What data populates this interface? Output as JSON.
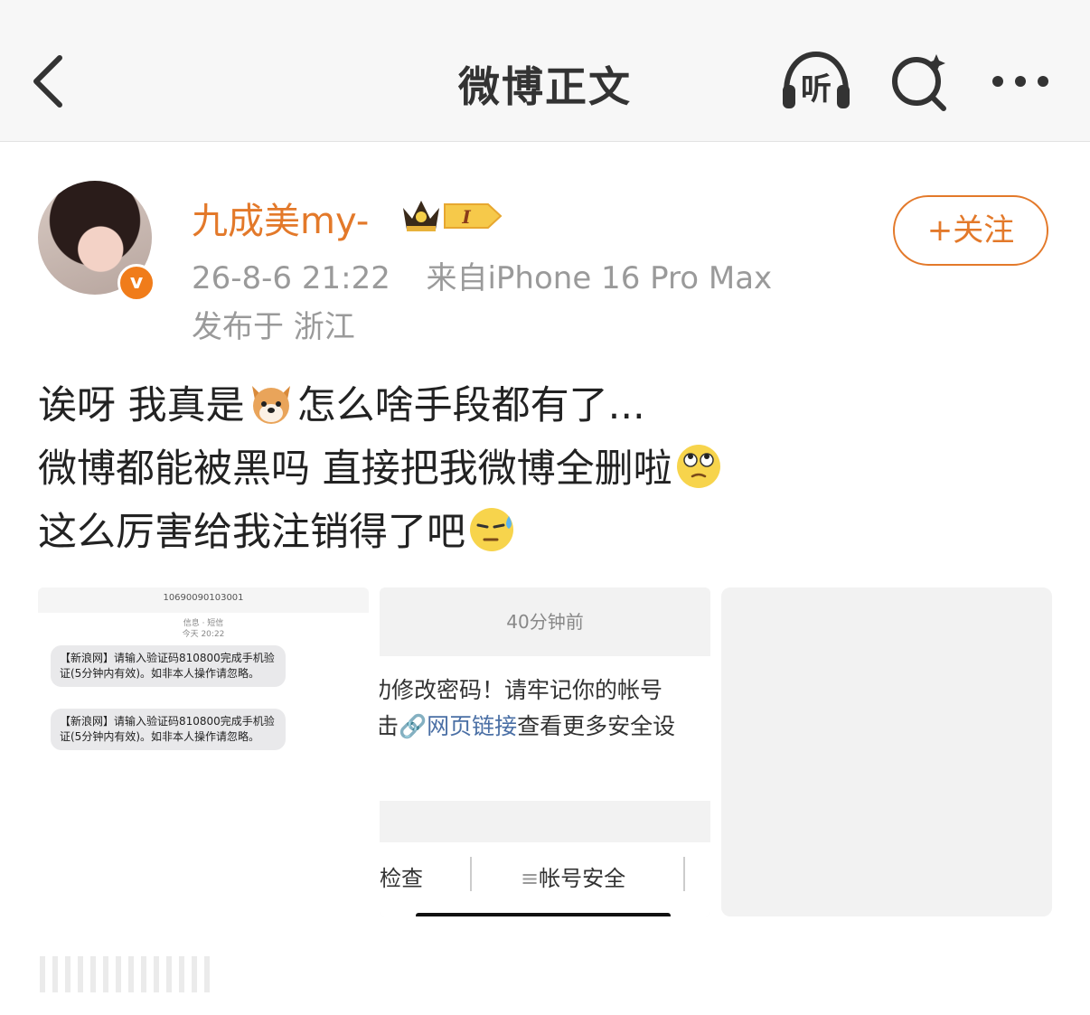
{
  "header": {
    "title": "微博正文",
    "listen_label": "听"
  },
  "post": {
    "username": "九成美my-",
    "level_badge": "I",
    "verified_mark": "v",
    "timestamp": "26-8-6 21:22",
    "source": "来自iPhone 16 Pro Max",
    "location": "发布于 浙江",
    "follow_label": "+关注",
    "text_lines": [
      {
        "before": "诶呀 我真是",
        "emoji": "dog-emoji",
        "after": "怎么啥手段都有了..."
      },
      {
        "before": "微博都能被黑吗 直接把我微博全删啦",
        "emoji": "eye-roll-emoji",
        "after": ""
      },
      {
        "before": "这么厉害给我注销得了吧",
        "emoji": "sweat-emoji",
        "after": ""
      }
    ]
  },
  "images": {
    "sms": {
      "sender": "10690090103001",
      "label_line1": "信息 · 短信",
      "label_line2": "今天 20:22",
      "messages": [
        "【新浪网】请输入验证码810800完成手机验证(5分钟内有效)。如非本人操作请忽略。",
        "【新浪网】请输入验证码810800完成手机验证(5分钟内有效)。如非本人操作请忽略。"
      ]
    },
    "notice": {
      "time": "40分钟前",
      "line1": "功修改密码！请牢记你的帐号",
      "line2_prefix": "击",
      "line2_link": "网页链接",
      "line2_suffix": "查看更多安全设",
      "bottom_left": "检查",
      "bottom_right": "帐号安全"
    }
  },
  "colors": {
    "accent_orange": "#e3792a",
    "link_blue": "#4a6fa5",
    "meta_gray": "#9a9a9a"
  }
}
